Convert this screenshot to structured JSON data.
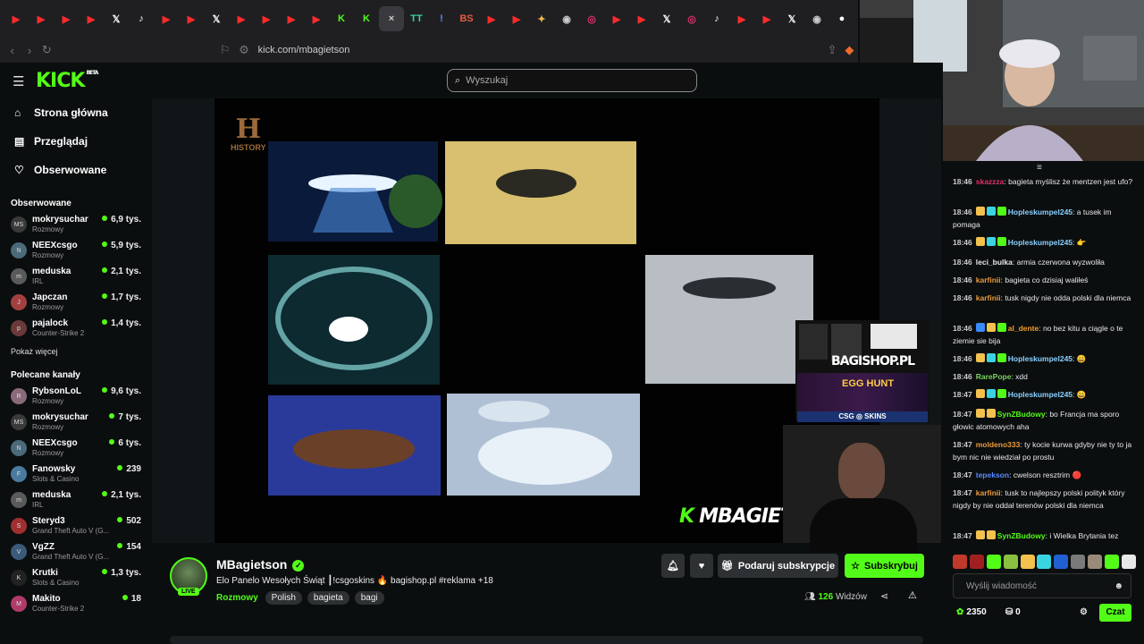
{
  "browser": {
    "tabs": [
      {
        "g": "▶",
        "c": "#ff2b2b"
      },
      {
        "g": "▶",
        "c": "#ff2b2b"
      },
      {
        "g": "▶",
        "c": "#ff2b2b"
      },
      {
        "g": "▶",
        "c": "#ff2b2b"
      },
      {
        "g": "𝕏",
        "c": "#ffffff"
      },
      {
        "g": "♪",
        "c": "#ffffff"
      },
      {
        "g": "▶",
        "c": "#ff2b2b"
      },
      {
        "g": "▶",
        "c": "#ff2b2b"
      },
      {
        "g": "𝕏",
        "c": "#ffffff"
      },
      {
        "g": "▶",
        "c": "#ff2b2b"
      },
      {
        "g": "▶",
        "c": "#ff2b2b"
      },
      {
        "g": "▶",
        "c": "#ff2b2b"
      },
      {
        "g": "▶",
        "c": "#ff2b2b"
      },
      {
        "g": "K",
        "c": "#53fc18"
      },
      {
        "g": "K",
        "c": "#53fc18"
      },
      {
        "g": "×",
        "c": "#cccccc",
        "active": true
      },
      {
        "g": "TT",
        "c": "#38d39f"
      },
      {
        "g": "!",
        "c": "#5b8cff"
      },
      {
        "g": "BS",
        "c": "#e85a3a"
      },
      {
        "g": "▶",
        "c": "#ff2b2b"
      },
      {
        "g": "▶",
        "c": "#ff2b2b"
      },
      {
        "g": "✦",
        "c": "#f2b84b"
      },
      {
        "g": "◉",
        "c": "#cccccc"
      },
      {
        "g": "◎",
        "c": "#e1306c"
      },
      {
        "g": "▶",
        "c": "#ff2b2b"
      },
      {
        "g": "▶",
        "c": "#ff2b2b"
      },
      {
        "g": "𝕏",
        "c": "#ffffff"
      },
      {
        "g": "◎",
        "c": "#e1306c"
      },
      {
        "g": "♪",
        "c": "#ffffff"
      },
      {
        "g": "▶",
        "c": "#ff2b2b"
      },
      {
        "g": "▶",
        "c": "#ff2b2b"
      },
      {
        "g": "𝕏",
        "c": "#ffffff"
      },
      {
        "g": "◉",
        "c": "#cccccc"
      },
      {
        "g": "●",
        "c": "#ffffff"
      }
    ],
    "url": "kick.com/mbagietson"
  },
  "header": {
    "logo": "KICK",
    "logo_sup": "BETA",
    "search_placeholder": "Wyszukaj"
  },
  "nav": [
    {
      "icon": "⌂",
      "label": "Strona główna"
    },
    {
      "icon": "▤",
      "label": "Przeglądaj"
    },
    {
      "icon": "♡",
      "label": "Obserwowane"
    }
  ],
  "following": {
    "title": "Obserwowane",
    "more": "Pokaż więcej",
    "channels": [
      {
        "name": "mokrysuchar",
        "cat": "Rozmowy",
        "viewers": "6,9 tys.",
        "av": "MS",
        "avc": "#3a3a3a"
      },
      {
        "name": "NEEXcsgo",
        "cat": "Rozmowy",
        "viewers": "5,9 tys.",
        "av": "N",
        "avc": "#4b6a7a"
      },
      {
        "name": "meduska",
        "cat": "IRL",
        "viewers": "2,1 tys.",
        "av": "m",
        "avc": "#5a5a5a"
      },
      {
        "name": "Japczan",
        "cat": "Rozmowy",
        "viewers": "1,7 tys.",
        "av": "J",
        "avc": "#a24040"
      },
      {
        "name": "pajalock",
        "cat": "Counter-Strike 2",
        "viewers": "1,4 tys.",
        "av": "p",
        "avc": "#6a3a3a"
      }
    ]
  },
  "recommended": {
    "title": "Polecane kanały",
    "channels": [
      {
        "name": "RybsonLoL",
        "cat": "Rozmowy",
        "viewers": "9,6 tys.",
        "av": "R",
        "avc": "#8a6a7a"
      },
      {
        "name": "mokrysuchar",
        "cat": "Rozmowy",
        "viewers": "7 tys.",
        "av": "MS",
        "avc": "#3a3a3a"
      },
      {
        "name": "NEEXcsgo",
        "cat": "Rozmowy",
        "viewers": "6 tys.",
        "av": "N",
        "avc": "#4b6a7a"
      },
      {
        "name": "Fanowsky",
        "cat": "Slots & Casino",
        "viewers": "239",
        "av": "F",
        "avc": "#4a7aa0"
      },
      {
        "name": "meduska",
        "cat": "IRL",
        "viewers": "2,1 tys.",
        "av": "m",
        "avc": "#5a5a5a"
      },
      {
        "name": "Steryd3",
        "cat": "Grand Theft Auto V (G...",
        "viewers": "502",
        "av": "S",
        "avc": "#a03030"
      },
      {
        "name": "VgZZ",
        "cat": "Grand Theft Auto V (G...",
        "viewers": "154",
        "av": "V",
        "avc": "#3a5a7a"
      },
      {
        "name": "Krutki",
        "cat": "Slots & Casino",
        "viewers": "1,3 tys.",
        "av": "K",
        "avc": "#222222"
      },
      {
        "name": "Makito",
        "cat": "Counter-Strike 2",
        "viewers": "18",
        "av": "M",
        "avc": "#b03a6a"
      }
    ]
  },
  "video": {
    "watermark": "MBAGIETSON",
    "history_logo": "HISTORY",
    "shop_text": "BAGISHOP.PL",
    "egg_text": "EGG HUNT",
    "csg_text": "CSG ◎ SKINS"
  },
  "stream": {
    "name": "MBagietson",
    "live": "LIVE",
    "title": "Elo Panelo Wesołych Świąt ┃!csgoskins 🔥 bagishop.pl #reklama +18",
    "category": "Rozmowy",
    "tags": [
      "Polish",
      "bagieta",
      "bagi"
    ],
    "viewers_count": "126",
    "viewers_label": "Widzów",
    "gift": "Podaruj subskrypcje",
    "subscribe": "Subskrybuj"
  },
  "chat": {
    "messages": [
      {
        "t": "18:46",
        "b": [],
        "u": "skazzza",
        "c": "#e0306a",
        "m": "bagieta myślisz że mentzen jest ufo?"
      },
      {
        "t": "18:46",
        "b": [
          "#f2c14e",
          "#3ad4e0",
          "#53fc18"
        ],
        "u": "Hopleskumpel245",
        "c": "#8ad0ff",
        "m": "a tusek im pomaga"
      },
      {
        "t": "18:46",
        "b": [
          "#f2c14e",
          "#3ad4e0",
          "#53fc18"
        ],
        "u": "Hopleskumpel245",
        "c": "#8ad0ff",
        "m": "👉"
      },
      {
        "t": "18:46",
        "b": [],
        "u": "leci_bulka",
        "c": "#e8e8e8",
        "m": "armia czerwona wyzwoliła"
      },
      {
        "t": "18:46",
        "b": [],
        "u": "karfinii",
        "c": "#e89a3c",
        "m": "bagieta co dzisiaj waliłeś"
      },
      {
        "t": "18:46",
        "b": [],
        "u": "karfinii",
        "c": "#e89a3c",
        "m": "tusk nigdy nie odda polski dla niemca"
      },
      {
        "t": "18:46",
        "b": [
          "#3a8aff",
          "#f2c14e",
          "#53fc18"
        ],
        "u": "al_dente",
        "c": "#f0a030",
        "m": "no bez kitu a ciągle o te ziemie sie bija"
      },
      {
        "t": "18:46",
        "b": [
          "#f2c14e",
          "#3ad4e0",
          "#53fc18"
        ],
        "u": "Hopleskumpel245",
        "c": "#8ad0ff",
        "m": "😀"
      },
      {
        "t": "18:46",
        "b": [],
        "u": "RarePope",
        "c": "#7ad060",
        "m": "xdd"
      },
      {
        "t": "18:47",
        "b": [
          "#f2c14e",
          "#3ad4e0",
          "#53fc18"
        ],
        "u": "Hopleskumpel245",
        "c": "#8ad0ff",
        "m": "😀"
      },
      {
        "t": "18:47",
        "b": [
          "#f2c14e",
          "#f2c14e"
        ],
        "u": "SynZBudowy",
        "c": "#53fc18",
        "m": "bo Francja ma sporo głowic atomowych aha"
      },
      {
        "t": "18:47",
        "b": [],
        "u": "moldeno333",
        "c": "#e89a3c",
        "m": "ty kocie kurwa gdyby nie ty to ja bym nic nie wiedział po prostu"
      },
      {
        "t": "18:47",
        "b": [],
        "u": "tepekson",
        "c": "#5a8aff",
        "m": "cwelson resztrim 🔴"
      },
      {
        "t": "18:47",
        "b": [],
        "u": "karfinii",
        "c": "#e89a3c",
        "m": "tusk to najlepszy polski polityk który nigdy by nie oddał terenów polski dla niemca"
      },
      {
        "t": "18:47",
        "b": [
          "#f2c14e",
          "#f2c14e"
        ],
        "u": "SynZBudowy",
        "c": "#53fc18",
        "m": "i Wielka Brytania tez"
      }
    ],
    "emote_colors": [
      "#c0392b",
      "#a02020",
      "#53fc18",
      "#8ac040",
      "#f2c14e",
      "#3ad4e0",
      "#2060d0",
      "#7a7a7a",
      "#9a8a7a",
      "#53fc18",
      "#e8e8e8"
    ],
    "input_placeholder": "Wyślij wiadomość",
    "points": "2350",
    "boxes": "0",
    "send": "Czat"
  }
}
